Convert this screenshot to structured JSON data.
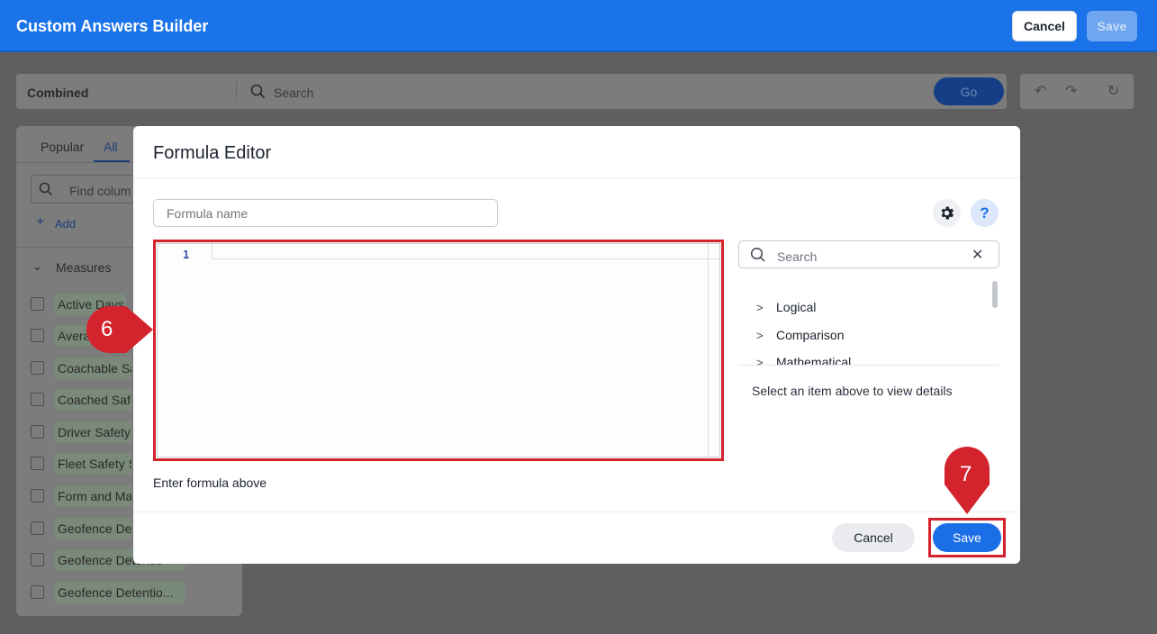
{
  "header": {
    "title": "Custom Answers Builder",
    "cancel_label": "Cancel",
    "save_label": "Save"
  },
  "searchbar": {
    "source": "Combined",
    "placeholder": "Search",
    "go_label": "Go"
  },
  "left_panel": {
    "tabs": [
      "Popular",
      "All"
    ],
    "active_tab": "All",
    "find_placeholder": "Find colum",
    "add_label": "Add",
    "section": "Measures",
    "items": [
      "Active Days",
      "Avera",
      "Coachable Sa",
      "Coached Safe",
      "Driver Safety S",
      "Fleet Safety S",
      "Form and Ma",
      "Geofence De",
      "Geofence Detentio",
      "Geofence Detentio..."
    ]
  },
  "modal": {
    "title": "Formula Editor",
    "name_placeholder": "Formula name",
    "line_number": "1",
    "hint": "Enter formula above",
    "search_placeholder": "Search",
    "categories": [
      "Logical",
      "Comparison",
      "Mathematical"
    ],
    "details_text": "Select an item above to view details",
    "cancel_label": "Cancel",
    "save_label": "Save",
    "help_label": "?"
  },
  "callouts": {
    "step6": "6",
    "step7": "7"
  },
  "colors": {
    "header_blue": "#1a73e8",
    "primary_button": "#1a6ee6",
    "highlight_red": "#d3232c",
    "overlay": "#5f5f5f"
  }
}
